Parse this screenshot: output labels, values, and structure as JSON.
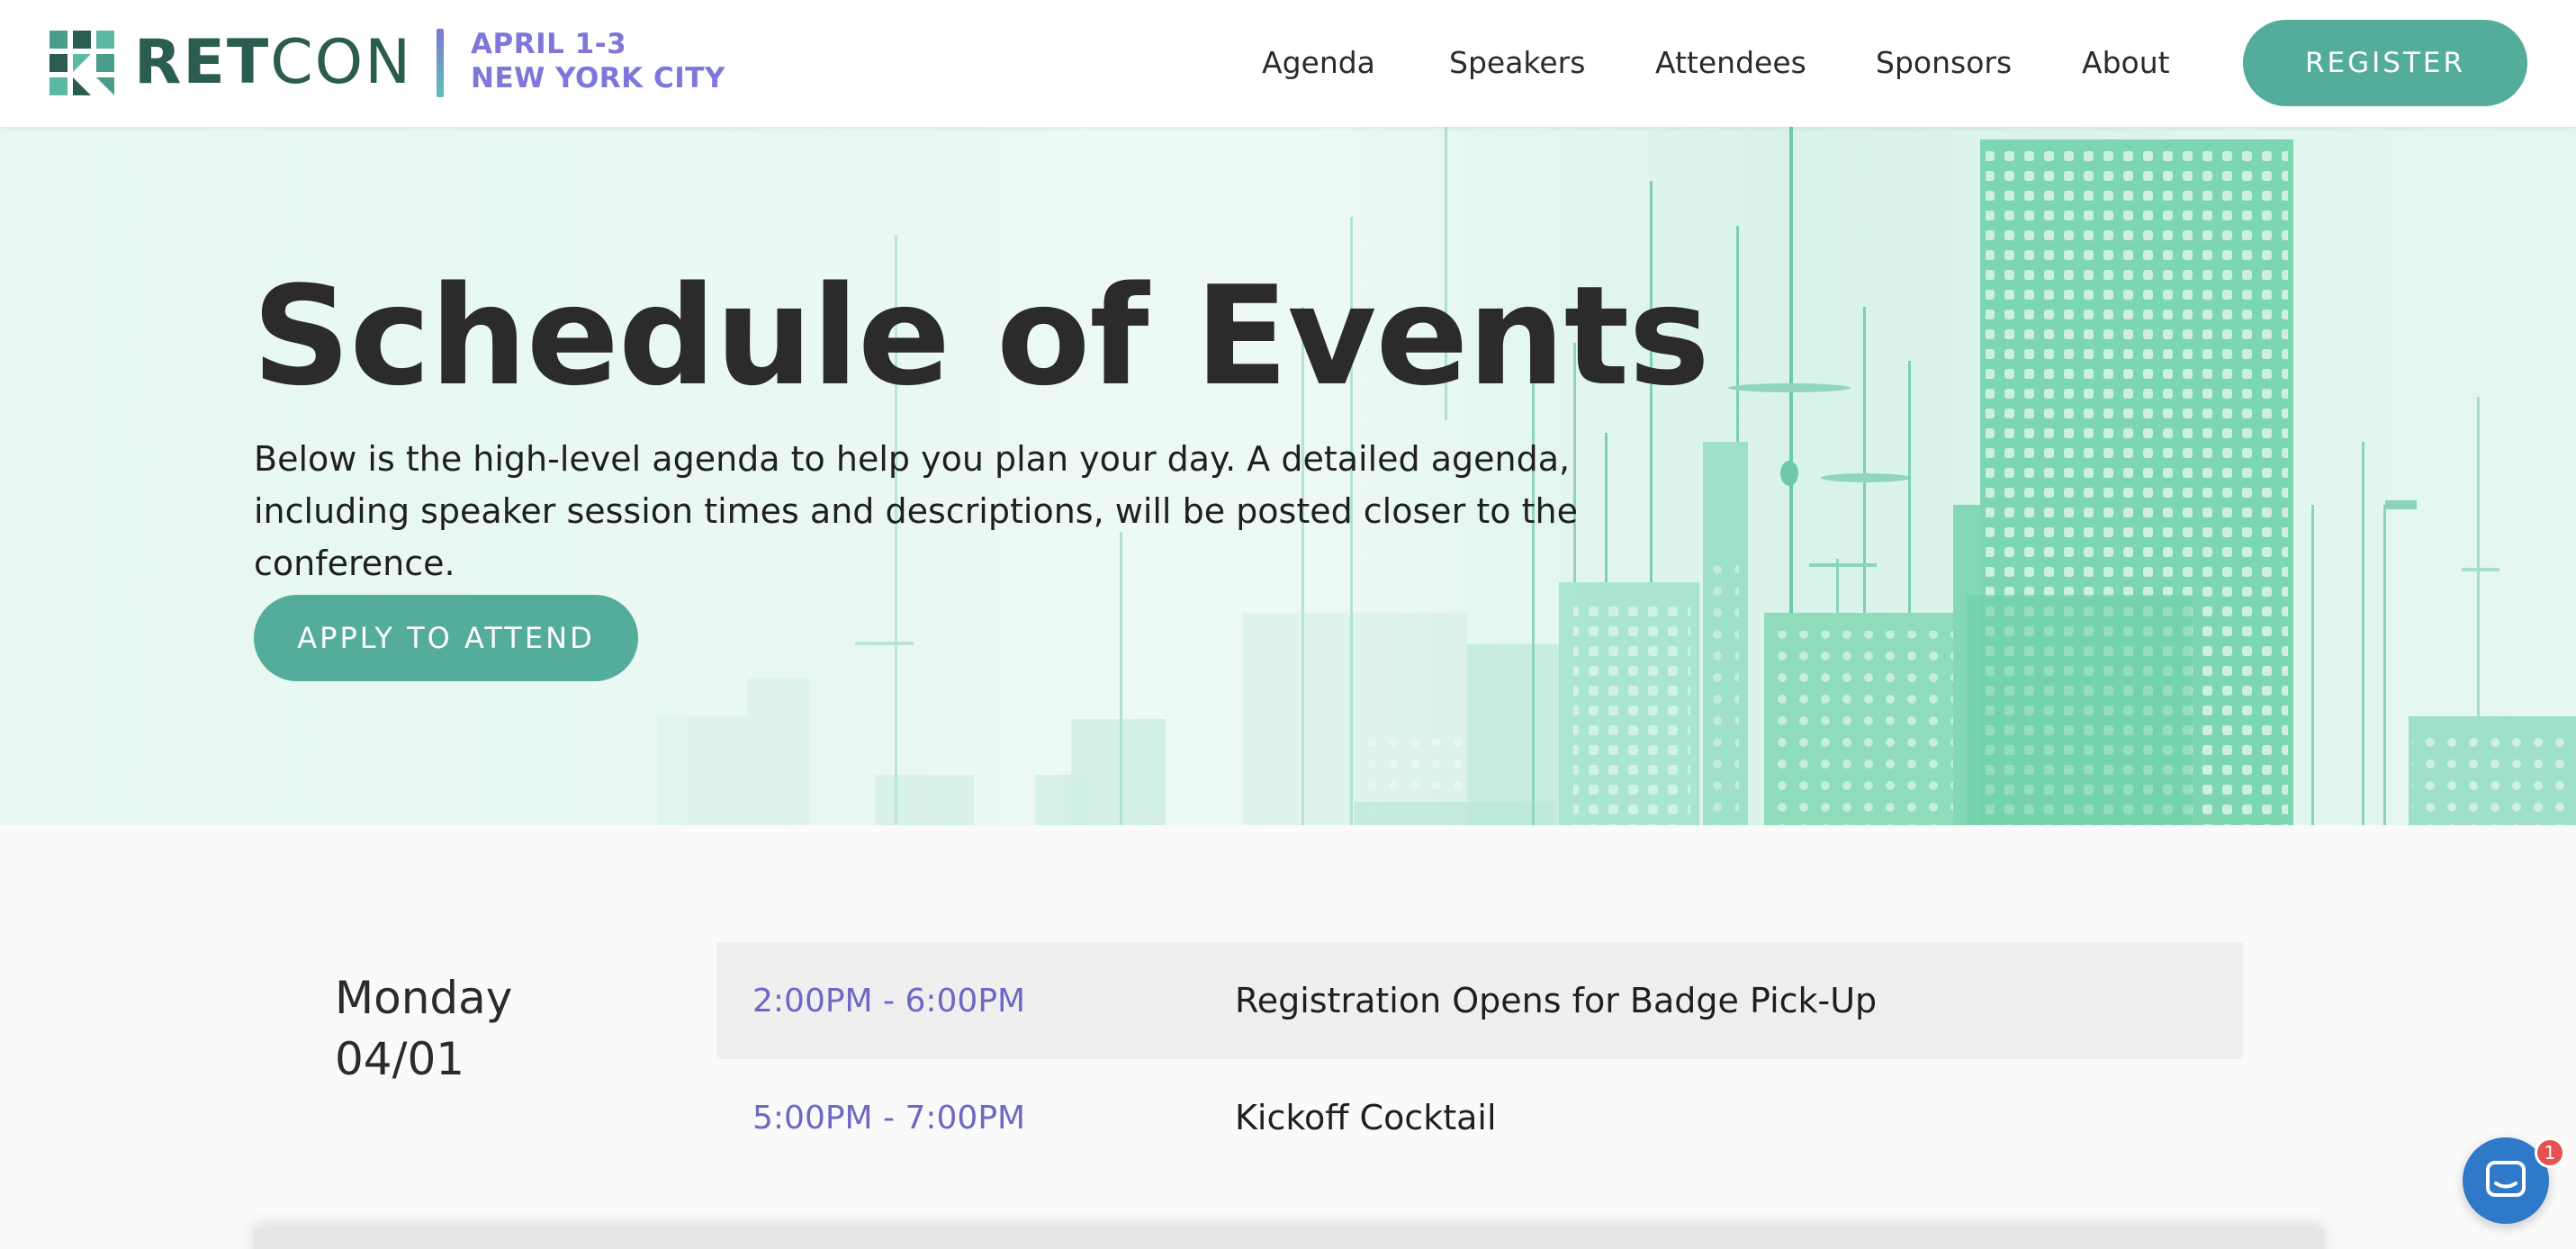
{
  "brand": {
    "name_bold": "RET",
    "name_light": "CON",
    "event_dates": "APRIL 1-3",
    "event_city": "NEW YORK CITY"
  },
  "nav": {
    "items": [
      {
        "label": "Agenda"
      },
      {
        "label": "Speakers"
      },
      {
        "label": "Attendees"
      },
      {
        "label": "Sponsors"
      },
      {
        "label": "About"
      }
    ],
    "register_label": "REGISTER"
  },
  "hero": {
    "title": "Schedule of Events",
    "description": "Below is the high-level agenda to help you plan your day. A detailed agenda, including speaker session times and descriptions, will be posted closer to the conference.",
    "cta_label": "APPLY TO ATTEND"
  },
  "schedule": {
    "day": {
      "weekday": "Monday",
      "date": "04/01"
    },
    "events": [
      {
        "time": "2:00PM - 6:00PM",
        "title": "Registration Opens for Badge Pick-Up"
      },
      {
        "time": "5:00PM - 7:00PM",
        "title": "Kickoff Cocktail"
      }
    ]
  },
  "chat": {
    "icon": "chat-icon",
    "unread_count": "1"
  },
  "colors": {
    "accent": "#53ad9a",
    "brand_dark": "#2a5d4f",
    "time_purple": "#6e68c4",
    "event_info": "#7e77d9"
  }
}
